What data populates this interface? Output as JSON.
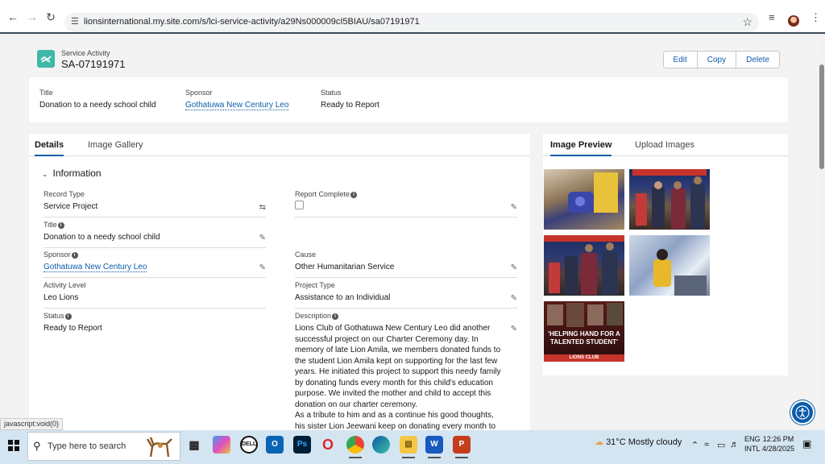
{
  "browser": {
    "url": "lionsinternational.my.site.com/s/lci-service-activity/a29Ns000009cI5BIAU/sa07191971"
  },
  "record": {
    "type_label": "Service Activity",
    "name": "SA-07191971",
    "actions": {
      "edit": "Edit",
      "copy": "Copy",
      "delete": "Delete"
    }
  },
  "highlights": {
    "title_label": "Title",
    "title_value": "Donation to a needy school child",
    "sponsor_label": "Sponsor",
    "sponsor_value": "Gothatuwa New Century Leo",
    "status_label": "Status",
    "status_value": "Ready to Report"
  },
  "left_tabs": {
    "details": "Details",
    "gallery": "Image Gallery"
  },
  "right_tabs": {
    "preview": "Image Preview",
    "upload": "Upload Images"
  },
  "section": {
    "title": "Information"
  },
  "fields": {
    "record_type": {
      "label": "Record Type",
      "value": "Service Project"
    },
    "report_complete": {
      "label": "Report Complete",
      "checked": false
    },
    "title": {
      "label": "Title",
      "value": "Donation to a needy school child"
    },
    "sponsor": {
      "label": "Sponsor",
      "value": "Gothatuwa New Century Leo"
    },
    "cause": {
      "label": "Cause",
      "value": "Other Humanitarian Service"
    },
    "activity_level": {
      "label": "Activity Level",
      "value": "Leo Lions"
    },
    "project_type": {
      "label": "Project Type",
      "value": "Assistance to an Individual"
    },
    "status": {
      "label": "Status",
      "value": "Ready to Report"
    },
    "description": {
      "label": "Description",
      "value_p1": "Lions Club of Gothatuwa New Century Leo did another successful project on our Charter Ceremony day. In memory of late Lion Amila, we members donated funds to the student Lion Amila kept on supporting for the last few years. He initiated this project to support this needy family by donating funds every month for this child's education purpose. We invited the mother and child to accept this donation on our charter ceremony.",
      "value_p2": "As a tribute to him and as a continue his good thoughts, his sister Lion Jeewani keep on donating every month to this student for his education."
    }
  },
  "gallery_poster": {
    "line1": "'HELPING HAND FOR A",
    "line2": "TALENTED STUDENT'",
    "footer": "LIONS CLUB"
  },
  "status_bar": {
    "text": "javascript:void(0)"
  },
  "taskbar": {
    "search_placeholder": "Type here to search",
    "apps": [
      "task-view",
      "copilot",
      "dell",
      "outlook",
      "photoshop",
      "opera",
      "chrome",
      "edge",
      "file-explorer",
      "word",
      "powerpoint"
    ],
    "weather": "31°C  Mostly cloudy",
    "lang_line1": "ENG",
    "lang_line2": "INTL",
    "time": "12:26 PM",
    "date": "4/28/2025"
  },
  "colors": {
    "accent": "#0b5cab",
    "record_icon": "#3fb8a8",
    "taskbar": "#d4e5f2"
  }
}
